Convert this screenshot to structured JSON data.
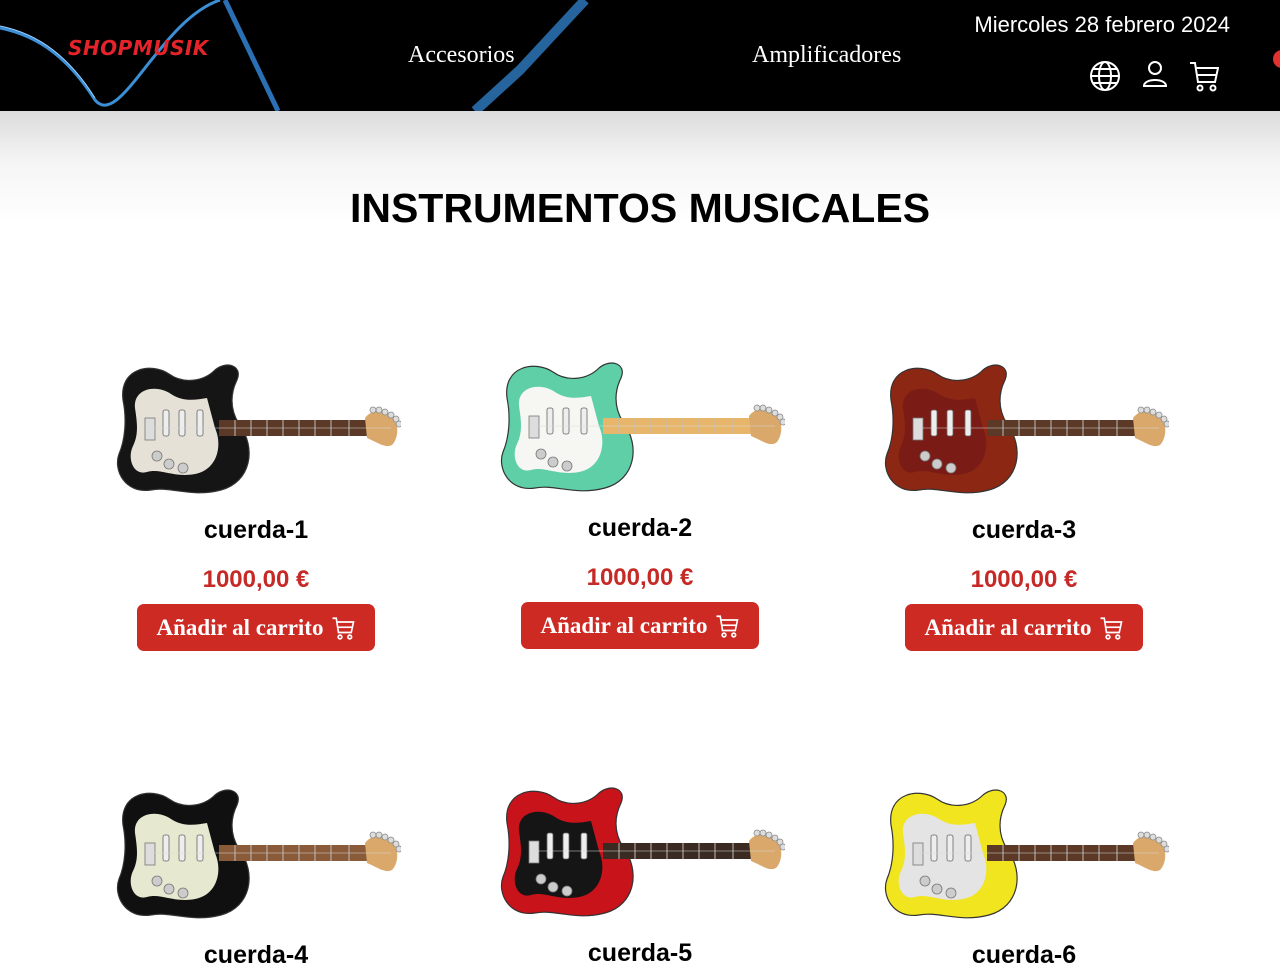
{
  "header": {
    "logo": "SHOPMUSIK",
    "nav": [
      {
        "label": "Accesorios"
      },
      {
        "label": "Amplificadores"
      }
    ],
    "date": "Miercoles 28 febrero 2024",
    "icons": [
      "globe-icon",
      "user-icon",
      "cart-icon"
    ]
  },
  "page": {
    "title": "INSTRUMENTOS MUSICALES"
  },
  "products": [
    {
      "name": "cuerda-1",
      "price": "1000,00 €",
      "button": "Añadir al carrito",
      "body_color": "#151515",
      "guard_color": "#e6e1d7",
      "neck_color": "#5b3926"
    },
    {
      "name": "cuerda-2",
      "price": "1000,00 €",
      "button": "Añadir al carrito",
      "body_color": "#5ecfa7",
      "guard_color": "#f6f6f2",
      "neck_color": "#e8b66b"
    },
    {
      "name": "cuerda-3",
      "price": "1000,00 €",
      "button": "Añadir al carrito",
      "body_color": "#8c2713",
      "guard_color": "#7a1b15",
      "neck_color": "#5b3926"
    },
    {
      "name": "cuerda-4",
      "price": "",
      "button": "",
      "body_color": "#101010",
      "guard_color": "#e7e8d0",
      "neck_color": "#8a5b39"
    },
    {
      "name": "cuerda-5",
      "price": "",
      "button": "",
      "body_color": "#c8131b",
      "guard_color": "#151515",
      "neck_color": "#3b2a22"
    },
    {
      "name": "cuerda-6",
      "price": "",
      "button": "",
      "body_color": "#f1e51f",
      "guard_color": "#e4e4e4",
      "neck_color": "#5b3926"
    }
  ],
  "colors": {
    "accent": "#cd2a24",
    "header_bg": "#000000",
    "logo": "#e5232b"
  }
}
